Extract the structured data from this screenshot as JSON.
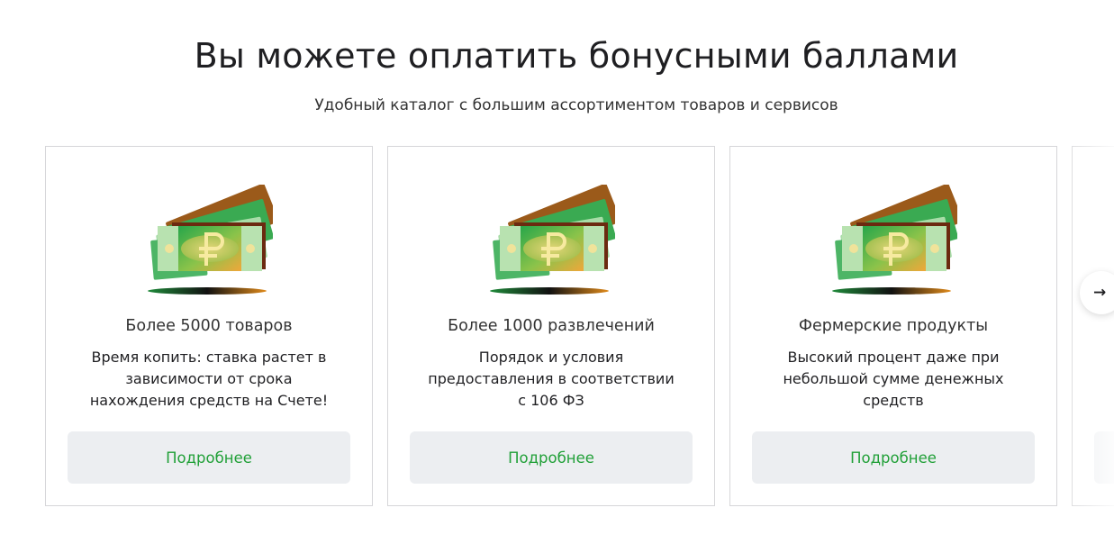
{
  "header": {
    "title": "Вы можете оплатить бонусными баллами",
    "subtitle": "Удобный каталог с большим ассортиментом товаров и сервисов"
  },
  "cards": [
    {
      "title": "Более 5000 товаров",
      "text": "Время копить: ставка растет в зависимости от срока нахождения средств на Счете!",
      "button_label": "Подробнее",
      "icon": "ruble-banknotes-icon"
    },
    {
      "title": "Более 1000 развлечений",
      "text": "Порядок и условия предоставления в соответствии с 106 ФЗ",
      "button_label": "Подробнее",
      "icon": "ruble-banknotes-icon"
    },
    {
      "title": "Фермерские продукты",
      "text": "Высокий процент даже при небольшой сумме денежных средств",
      "button_label": "Подробнее",
      "icon": "ruble-banknotes-icon"
    }
  ],
  "carousel": {
    "next_icon": "arrow-right-icon",
    "next_glyph": "→"
  },
  "colors": {
    "accent_green": "#21a038",
    "button_bg": "#eceef1",
    "card_border": "#d6d6d9",
    "text_dark": "#1f1f22"
  }
}
